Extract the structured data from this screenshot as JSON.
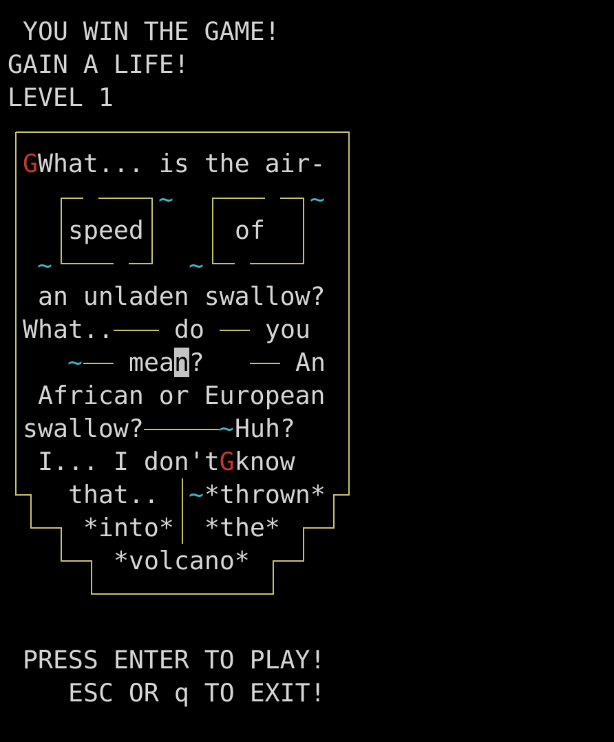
{
  "status": {
    "line1": " YOU WIN THE GAME!",
    "line2": "GAIN A LIFE!",
    "line3": "LEVEL 1"
  },
  "board": {
    "marker_g": "G",
    "question": "What... is the air-",
    "tilde": "~",
    "word_speed": "speed",
    "word_of": "of",
    "line_unladen": "an unladen swallow?",
    "what_prefix": "What..",
    "word_do": "do",
    "word_you": "you",
    "mea": "mea",
    "cursor_char": "n",
    "question_mark": "?",
    "word_an": "An",
    "line_african": "African or European",
    "swallow_q": "swallow?",
    "huh": "Huh?",
    "i_dont": "I... I don't",
    "know": "know",
    "that": "that..",
    "thrown": "*thrown*",
    "into": "*into*",
    "the": "*the*",
    "volcano": "*volcano*"
  },
  "prompt": {
    "enter": "PRESS ENTER TO PLAY!",
    "exit": "ESC OR q TO EXIT!"
  },
  "colors": {
    "text": "#d6d6d6",
    "frame": "#c9c46a",
    "red_marker": "#c8372d",
    "tilde": "#3cb8c8",
    "background": "#000000"
  }
}
